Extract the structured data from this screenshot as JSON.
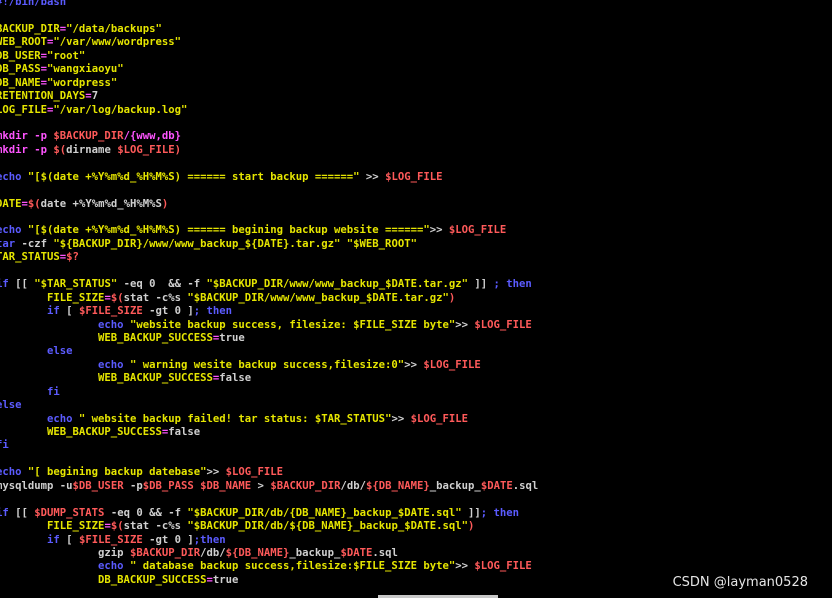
{
  "colors": {
    "default": "#d0d0d0",
    "var": "#e6e600",
    "str": "#e6e600",
    "kw": "#5b5bff",
    "dollar": "#ff5a5a",
    "op": "#ff55ff",
    "cmd": "#d0d0d0",
    "comment": "#5b5bff"
  },
  "terminal": {
    "lines": [
      [
        [
          "comment",
          "#!/bin/bash"
        ]
      ],
      [],
      [
        [
          "var",
          "BACKUP_DIR"
        ],
        [
          "op",
          "="
        ],
        [
          "str",
          "\"/data/backups\""
        ]
      ],
      [
        [
          "var",
          "WEB_ROOT"
        ],
        [
          "op",
          "="
        ],
        [
          "str",
          "\"/var/www/wordpress\""
        ]
      ],
      [
        [
          "var",
          "DB_USER"
        ],
        [
          "op",
          "="
        ],
        [
          "str",
          "\"root\""
        ]
      ],
      [
        [
          "var",
          "DB_PASS"
        ],
        [
          "op",
          "="
        ],
        [
          "str",
          "\"wangxiaoyu\""
        ]
      ],
      [
        [
          "var",
          "DB_NAME"
        ],
        [
          "op",
          "="
        ],
        [
          "str",
          "\"wordpress\""
        ]
      ],
      [
        [
          "var",
          "RETENTION_DAYS"
        ],
        [
          "op",
          "="
        ],
        [
          "default",
          "7"
        ]
      ],
      [
        [
          "var",
          "LOG_FILE"
        ],
        [
          "op",
          "="
        ],
        [
          "str",
          "\"/var/log/backup.log\""
        ]
      ],
      [],
      [
        [
          "op",
          "mkdir -p "
        ],
        [
          "dollar",
          "$BACKUP_DIR"
        ],
        [
          "op",
          "/{www,db}"
        ]
      ],
      [
        [
          "op",
          "mkdir -p "
        ],
        [
          "dollar",
          "$("
        ],
        [
          "default",
          "dirname "
        ],
        [
          "dollar",
          "$LOG_FILE"
        ],
        [
          "dollar",
          ")"
        ]
      ],
      [],
      [
        [
          "kw",
          "echo "
        ],
        [
          "str",
          "\"[$(date +%Y%m%d_%H%M%S) ====== start backup ======\""
        ],
        [
          "default",
          " >> "
        ],
        [
          "dollar",
          "$LOG_FILE"
        ]
      ],
      [],
      [
        [
          "var",
          "DATE"
        ],
        [
          "op",
          "="
        ],
        [
          "dollar",
          "$("
        ],
        [
          "default",
          "date +%Y%m%d_%H%M%S"
        ],
        [
          "dollar",
          ")"
        ]
      ],
      [],
      [
        [
          "kw",
          "echo "
        ],
        [
          "str",
          "\"[$(date +%Y%m%d_%H%M%S) ====== begining backup website ======\""
        ],
        [
          "default",
          ">> "
        ],
        [
          "dollar",
          "$LOG_FILE"
        ]
      ],
      [
        [
          "kw",
          "tar "
        ],
        [
          "default",
          "-czf "
        ],
        [
          "str",
          "\"${BACKUP_DIR}/www/www_backup_${DATE}.tar.gz\" \"$WEB_ROOT\""
        ]
      ],
      [
        [
          "var",
          "TAR_STATUS"
        ],
        [
          "op",
          "="
        ],
        [
          "dollar",
          "$?"
        ]
      ],
      [],
      [
        [
          "kw",
          "if "
        ],
        [
          "default",
          "[[ "
        ],
        [
          "str",
          "\"$TAR_STATUS\" "
        ],
        [
          "default",
          "-eq 0  && -f "
        ],
        [
          "str",
          "\"$BACKUP_DIR/www/www_backup_$DATE.tar.gz\""
        ],
        [
          "default",
          " ]] "
        ],
        [
          "kw",
          "; then"
        ]
      ],
      [
        [
          "var",
          "        FILE_SIZE"
        ],
        [
          "op",
          "="
        ],
        [
          "dollar",
          "$("
        ],
        [
          "default",
          "stat -c%s "
        ],
        [
          "str",
          "\"$BACKUP_DIR/www/www_backup_$DATE.tar.gz\""
        ],
        [
          "dollar",
          ")"
        ]
      ],
      [
        [
          "kw",
          "        if "
        ],
        [
          "default",
          "[ "
        ],
        [
          "dollar",
          "$FILE_SIZE"
        ],
        [
          "default",
          " -gt 0 ]"
        ],
        [
          "kw",
          "; then"
        ]
      ],
      [
        [
          "kw",
          "                echo "
        ],
        [
          "str",
          "\"website backup success, filesize: $FILE_SIZE byte\""
        ],
        [
          "default",
          ">> "
        ],
        [
          "dollar",
          "$LOG_FILE"
        ]
      ],
      [
        [
          "var",
          "                WEB_BACKUP_SUCCESS"
        ],
        [
          "op",
          "="
        ],
        [
          "default",
          "true"
        ]
      ],
      [
        [
          "kw",
          "        else"
        ]
      ],
      [
        [
          "kw",
          "                echo "
        ],
        [
          "str",
          "\" warning wesite backup success,filesize:0\""
        ],
        [
          "default",
          ">> "
        ],
        [
          "dollar",
          "$LOG_FILE"
        ]
      ],
      [
        [
          "var",
          "                WEB_BACKUP_SUCCESS"
        ],
        [
          "op",
          "="
        ],
        [
          "default",
          "false"
        ]
      ],
      [
        [
          "kw",
          "        fi"
        ]
      ],
      [
        [
          "kw",
          "else"
        ]
      ],
      [
        [
          "kw",
          "        echo "
        ],
        [
          "str",
          "\" website backup failed! tar status: $TAR_STATUS\""
        ],
        [
          "default",
          ">> "
        ],
        [
          "dollar",
          "$LOG_FILE"
        ]
      ],
      [
        [
          "var",
          "        WEB_BACKUP_SUCCESS"
        ],
        [
          "op",
          "="
        ],
        [
          "default",
          "false"
        ]
      ],
      [
        [
          "kw",
          "fi"
        ]
      ],
      [],
      [
        [
          "kw",
          "echo "
        ],
        [
          "str",
          "\"[ begining backup datebase\""
        ],
        [
          "default",
          ">> "
        ],
        [
          "dollar",
          "$LOG_FILE"
        ]
      ],
      [
        [
          "default",
          "mysqldump -u"
        ],
        [
          "dollar",
          "$DB_USER"
        ],
        [
          "default",
          " -p"
        ],
        [
          "dollar",
          "$DB_PASS"
        ],
        [
          "default",
          " "
        ],
        [
          "dollar",
          "$DB_NAME"
        ],
        [
          "default",
          " > "
        ],
        [
          "dollar",
          "$BACKUP_DIR"
        ],
        [
          "default",
          "/db/"
        ],
        [
          "dollar",
          "${DB_NAME}"
        ],
        [
          "default",
          "_backup_"
        ],
        [
          "dollar",
          "$DATE"
        ],
        [
          "default",
          ".sql"
        ]
      ],
      [],
      [
        [
          "kw",
          "if "
        ],
        [
          "default",
          "[[ "
        ],
        [
          "dollar",
          "$DUMP_STATS"
        ],
        [
          "default",
          " -eq 0 && -f "
        ],
        [
          "str",
          "\"$BACKUP_DIR/db/{DB_NAME}_backup_$DATE.sql\""
        ],
        [
          "default",
          " ]]"
        ],
        [
          "kw",
          "; then"
        ]
      ],
      [
        [
          "var",
          "        FILE_SIZE"
        ],
        [
          "op",
          "="
        ],
        [
          "dollar",
          "$("
        ],
        [
          "default",
          "stat -c%s "
        ],
        [
          "str",
          "\"$BACKUP_DIR/db/${DB_NAME}_backup_$DATE.sql\""
        ],
        [
          "dollar",
          ")"
        ]
      ],
      [
        [
          "kw",
          "        if "
        ],
        [
          "default",
          "[ "
        ],
        [
          "dollar",
          "$FILE_SIZE"
        ],
        [
          "default",
          " -gt 0 ]"
        ],
        [
          "kw",
          ";then"
        ]
      ],
      [
        [
          "default",
          "                gzip "
        ],
        [
          "dollar",
          "$BACKUP_DIR"
        ],
        [
          "default",
          "/db/"
        ],
        [
          "dollar",
          "${DB_NAME}"
        ],
        [
          "default",
          "_backup_"
        ],
        [
          "dollar",
          "$DATE"
        ],
        [
          "default",
          ".sql"
        ]
      ],
      [
        [
          "kw",
          "                echo "
        ],
        [
          "str",
          "\" database backup success,filesize:$FILE_SIZE byte\""
        ],
        [
          "default",
          ">> "
        ],
        [
          "dollar",
          "$LOG_FILE"
        ]
      ],
      [
        [
          "var",
          "                DB_BACKUP_SUCCESS"
        ],
        [
          "op",
          "="
        ],
        [
          "default",
          "true"
        ]
      ]
    ]
  },
  "watermark": "CSDN @layman0528"
}
